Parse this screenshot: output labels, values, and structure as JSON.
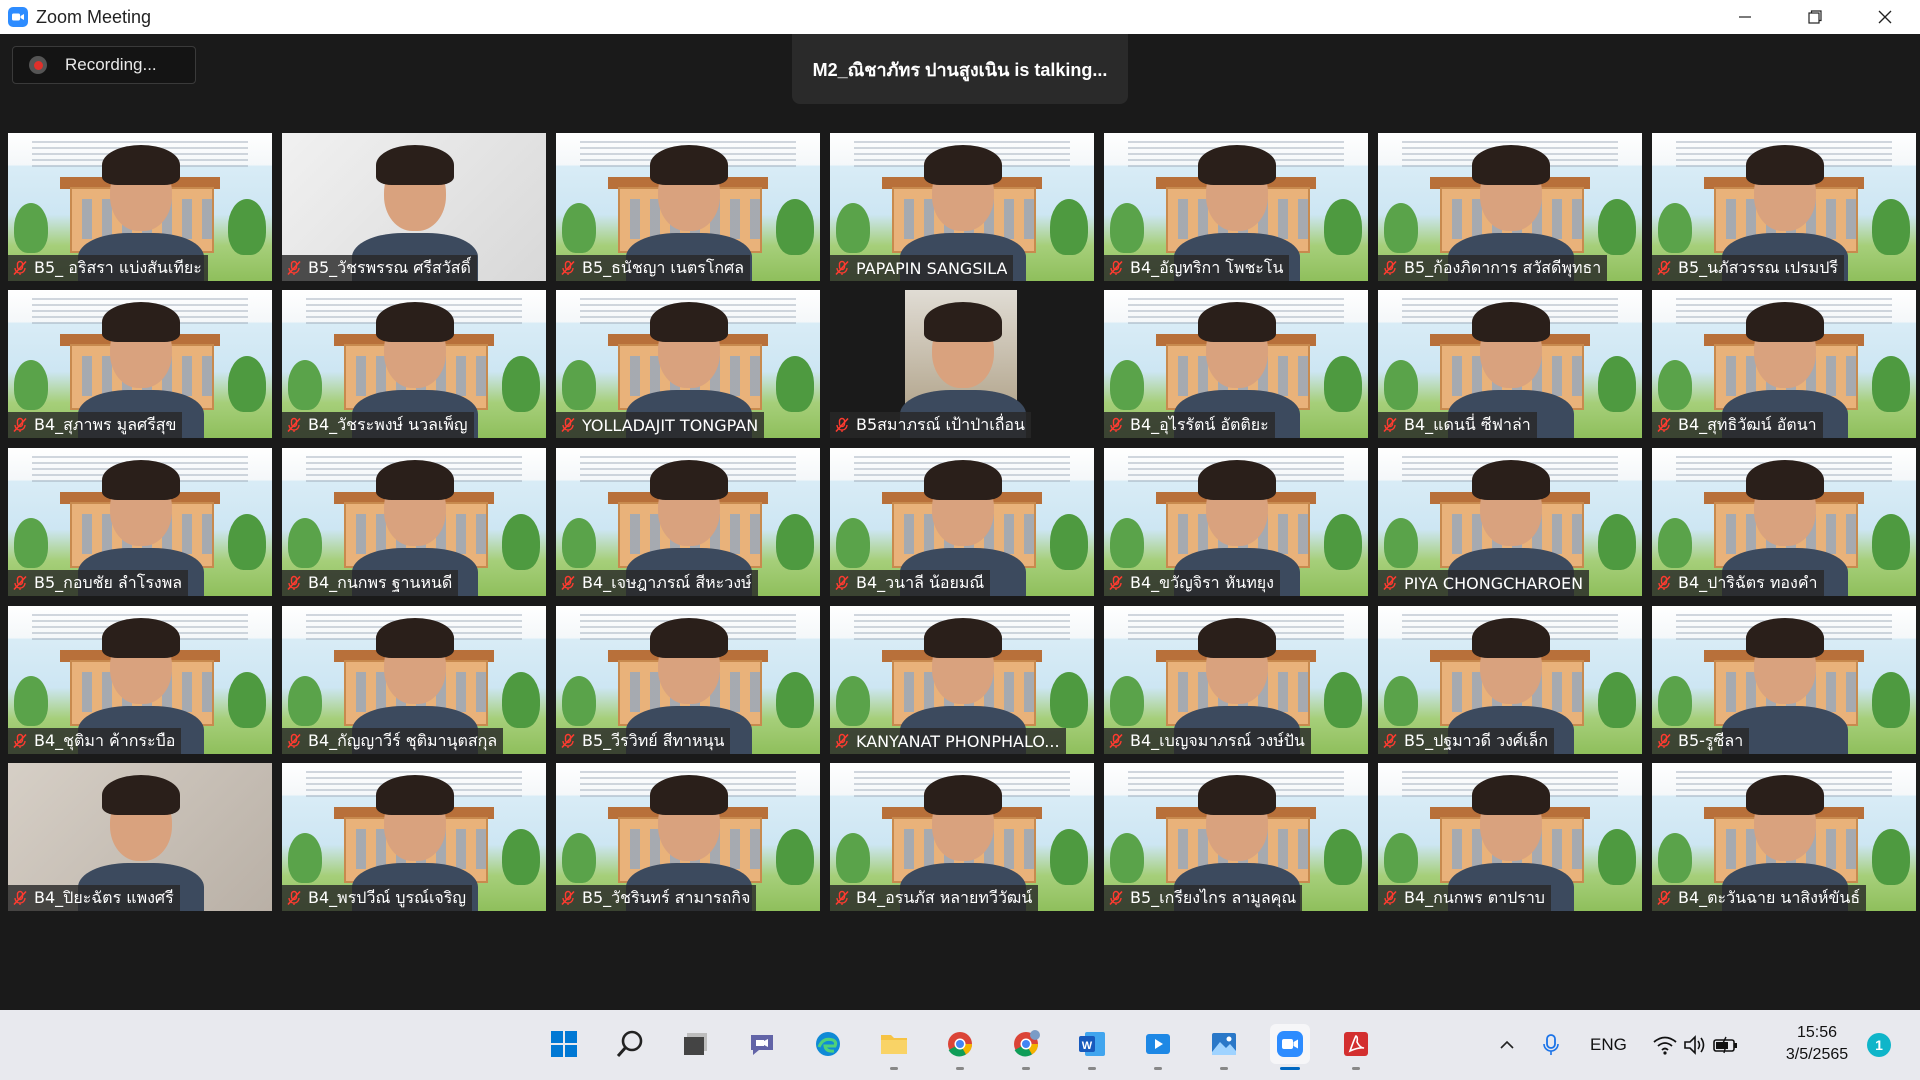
{
  "window": {
    "title": "Zoom Meeting"
  },
  "recording": {
    "label": "Recording..."
  },
  "talking": {
    "text": "M2_ณิชาภัทร ปานสูงเนิน is  talking..."
  },
  "participants": [
    {
      "name": "B5_ อริสรา แบ่งสันเทียะ",
      "bg": "school"
    },
    {
      "name": "B5_วัชรพรรณ ศรีสวัสดิ์",
      "bg": "plain"
    },
    {
      "name": "B5_ธนัชญา เนตรโกศล",
      "bg": "school"
    },
    {
      "name": "PAPAPIN SANGSILA",
      "bg": "school"
    },
    {
      "name": "B4_อัญทริกา โพชะโน",
      "bg": "school"
    },
    {
      "name": "B5_ก้องภิดาการ สวัสดีพุทธา",
      "bg": "school"
    },
    {
      "name": "B5_นภัสวรรณ เปรมปรี",
      "bg": "school"
    },
    {
      "name": "B4_สุภาพร มูลศรีสุข",
      "bg": "school"
    },
    {
      "name": "B4_วัชระพงษ์ นวลเพ็ญ",
      "bg": "school"
    },
    {
      "name": "YOLLADAJIT TONGPAN",
      "bg": "school"
    },
    {
      "name": "B5สมาภรณ์ เป้าป่าเถื่อน",
      "bg": "pic"
    },
    {
      "name": "B4_อุไรรัตน์ อัตติยะ",
      "bg": "school"
    },
    {
      "name": "B4_แดนนี่ ซีฟาล่า",
      "bg": "school"
    },
    {
      "name": "B4_สุทธิวัฒน์ อัตนา",
      "bg": "school"
    },
    {
      "name": "B5_กอบชัย  ลำโรงพล",
      "bg": "school"
    },
    {
      "name": "B4_กนกพร ฐานหนดี",
      "bg": "school"
    },
    {
      "name": "B4_เจษฎาภรณ์ สีหะวงษ์",
      "bg": "school"
    },
    {
      "name": "B4_วนาลี น้อยมณี",
      "bg": "school"
    },
    {
      "name": "B4_ขวัญจิรา หันทยุง",
      "bg": "school"
    },
    {
      "name": "PIYA CHONGCHAROEN",
      "bg": "school"
    },
    {
      "name": "B4_ปาริฉัตร ทองคำ",
      "bg": "school"
    },
    {
      "name": "B4_ชุติมา ค้ากระบือ",
      "bg": "school"
    },
    {
      "name": "B4_กัญญาวีร์ ชุติมานุตสกุล",
      "bg": "school"
    },
    {
      "name": "B5_วีรวิทย์ สีทาหนุน",
      "bg": "school"
    },
    {
      "name": "KANYANAT PHONPHALO...",
      "bg": "school"
    },
    {
      "name": "B4_เบญจมาภรณ์ วงษ์ปัน",
      "bg": "school"
    },
    {
      "name": "B5_ปฐมาวดี วงศ์เล็ก",
      "bg": "school"
    },
    {
      "name": "B5-รูซีลา",
      "bg": "school"
    },
    {
      "name": "B4_ปิยะฉัตร แพงศรี",
      "bg": "room"
    },
    {
      "name": "B4_พรปวีณ์ บูรณ์เจริญ",
      "bg": "school"
    },
    {
      "name": "B5_วัชรินทร์ สามารถกิจ",
      "bg": "school"
    },
    {
      "name": "B4_อรนภัส หลายทวีวัฒน์",
      "bg": "school"
    },
    {
      "name": "B5_เกรียงไกร ลามูลคุณ",
      "bg": "school"
    },
    {
      "name": "B4_กนกพร ตาปราบ",
      "bg": "school"
    },
    {
      "name": "B4_ตะวันฉาย นาสิงห์ขันธ์",
      "bg": "school"
    }
  ],
  "taskbar": {
    "apps": [
      {
        "id": "start",
        "icon": "windows-start-icon",
        "color": "#0078d4"
      },
      {
        "id": "search",
        "icon": "search-icon",
        "color": "#222222"
      },
      {
        "id": "taskview",
        "icon": "task-view-icon",
        "color": "#444444"
      },
      {
        "id": "chat",
        "icon": "teams-chat-icon",
        "color": "#6264a7"
      },
      {
        "id": "edge",
        "icon": "edge-icon",
        "color": "#0f8ad6"
      },
      {
        "id": "explorer",
        "icon": "folder-icon",
        "color": "#f6c344"
      },
      {
        "id": "chrome",
        "icon": "chrome-icon",
        "color": "#db4437"
      },
      {
        "id": "chrome2",
        "icon": "chrome-profile-icon",
        "color": "#0f9d58"
      },
      {
        "id": "word",
        "icon": "word-icon",
        "color": "#185abd"
      },
      {
        "id": "media",
        "icon": "media-player-icon",
        "color": "#1e88e5"
      },
      {
        "id": "photos",
        "icon": "photos-icon",
        "color": "#2a78c8"
      },
      {
        "id": "zoom",
        "icon": "zoom-icon",
        "color": "#2d8cff"
      },
      {
        "id": "acrobat",
        "icon": "acrobat-icon",
        "color": "#d32f2f"
      }
    ],
    "language": "ENG",
    "time": "15:56",
    "date": "3/5/2565",
    "notifications": "1"
  }
}
